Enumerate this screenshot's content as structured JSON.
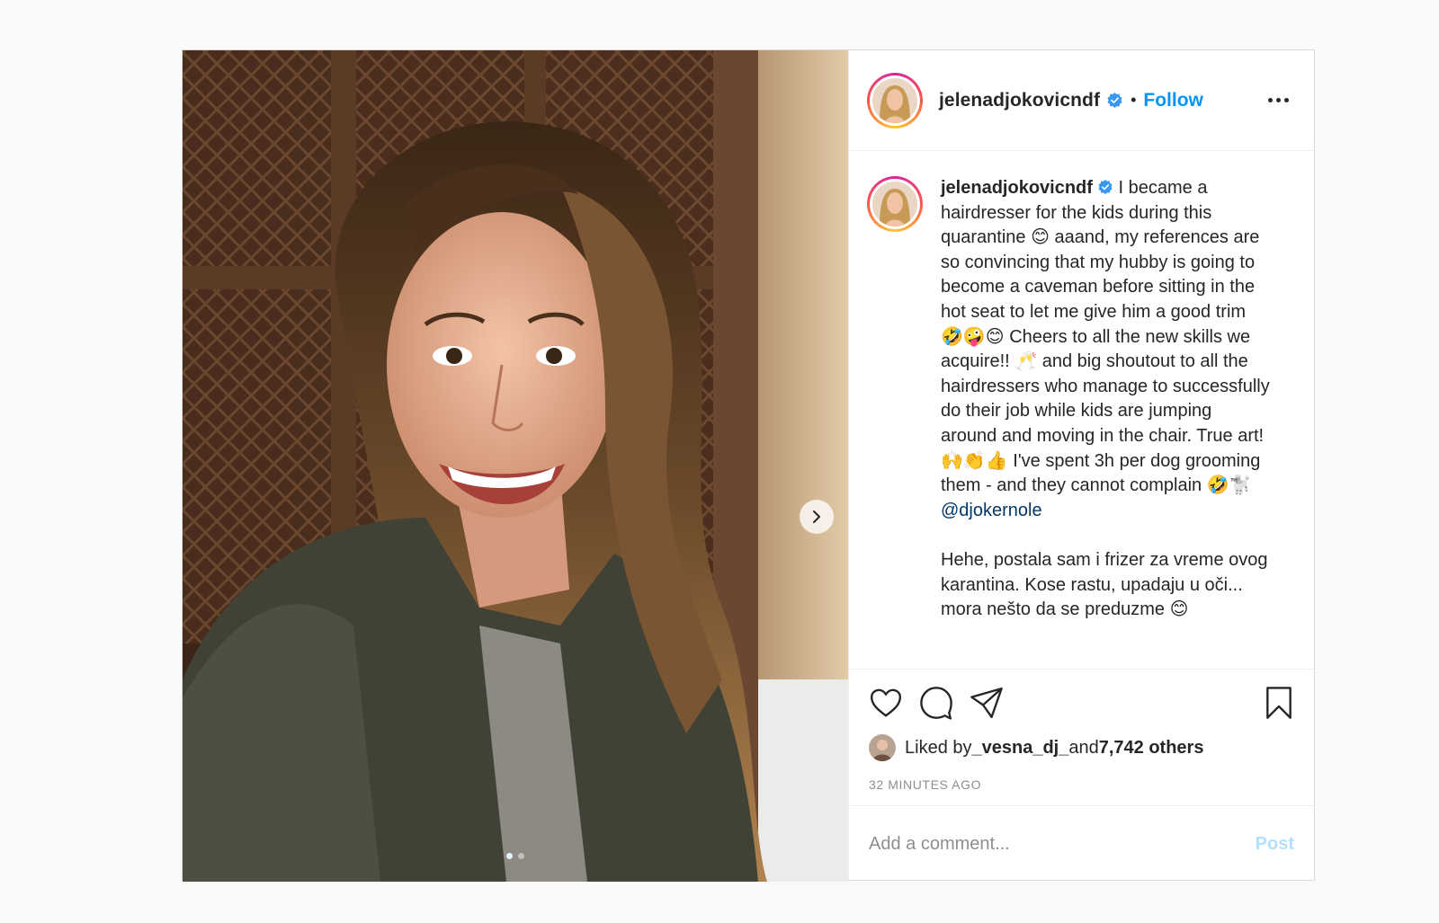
{
  "post": {
    "username": "jelenadjokovicndf",
    "separator": "•",
    "follow_label": "Follow",
    "more_icon": "more-horizontal-icon",
    "verified_color": "#3897f0",
    "accent": "#0095f6"
  },
  "media": {
    "description_icon": "photo",
    "next_icon": "chevron-right-icon",
    "carousel_count": 2,
    "carousel_active_index": 0
  },
  "caption": {
    "username": "jelenadjokovicndf",
    "text_1": " I became a hairdresser for the kids during this quarantine 😊 aaand, my references are so convincing that my hubby is going to become a caveman before sitting in the hot seat to let me give him a good trim 🤣🤪😊 Cheers to all the new skills we acquire!! 🥂 and big shoutout to all the hairdressers who manage to successfully do their job while kids are jumping around and moving in the chair. True art! 🙌👏👍 I've spent 3h per dog grooming them - and they cannot complain 🤣🐩\n",
    "mention": "@djokernole",
    "text_2": "\n\nHehe, postala sam i frizer za vreme ovog karantina. Kose rastu, upadaju u oči... mora nešto da se preduzme 😊"
  },
  "actions": {
    "like_icon": "heart-icon",
    "comment_icon": "comment-icon",
    "share_icon": "share-icon",
    "save_icon": "bookmark-icon"
  },
  "likes": {
    "prefix": "Liked by ",
    "user": "_vesna_dj_",
    "middle": " and ",
    "others": "7,742 others"
  },
  "timestamp": "32 MINUTES AGO",
  "comment": {
    "placeholder": "Add a comment...",
    "post_label": "Post"
  }
}
